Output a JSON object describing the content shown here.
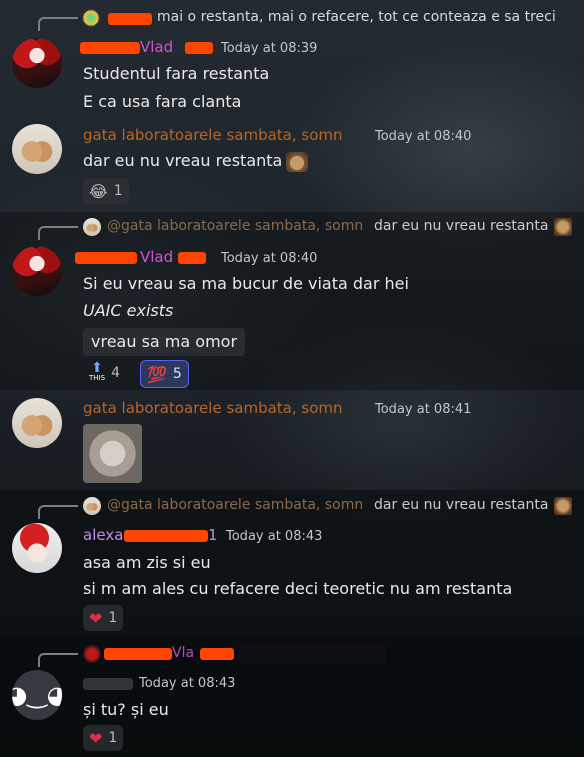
{
  "reply_top": {
    "text": "mai o restanta, mai o refacere, tot ce conteaza e sa treci"
  },
  "messages": {
    "m1": {
      "author": "Vlad",
      "time": "Today at 08:39",
      "lines": [
        "Studentul fara restanta",
        "E ca usa fara clanta"
      ]
    },
    "m2": {
      "author": "gata laboratoarele sambata, somn",
      "time": "Today at 08:40",
      "text": "dar eu nu vreau restanta",
      "reaction": {
        "emoji": "😂",
        "count": "1"
      }
    },
    "m3": {
      "reply_author": "@gata laboratoarele sambata, somn",
      "reply_text": "dar eu nu vreau restanta",
      "author": "Vlad",
      "time": "Today at 08:40",
      "lines": [
        "Si eu vreau sa ma bucur de viata dar hei",
        "UAIC exists"
      ],
      "embed": "vreau sa ma omor",
      "reactions": [
        {
          "emoji": "⬆",
          "label": "THIS",
          "count": "4"
        },
        {
          "emoji": "💯",
          "count": "5"
        }
      ]
    },
    "m4": {
      "author": "gata laboratoarele sambata, somn",
      "time": "Today at 08:41"
    },
    "m5": {
      "reply_author": "@gata laboratoarele sambata, somn",
      "reply_text": "dar eu nu vreau restanta",
      "author": "alexa",
      "author_suffix": "1",
      "time": "Today at 08:43",
      "lines": [
        "asa am zis si eu",
        "si m am ales cu refacere deci teoretic nu am restanta"
      ],
      "reaction": {
        "emoji": "❤",
        "count": "1"
      }
    },
    "m6": {
      "reply_author": "Vla",
      "time": "Today at 08:43",
      "text": "și tu? și eu",
      "reaction": {
        "emoji": "❤",
        "count": "1"
      }
    }
  },
  "colors": {
    "vlad": "#d451d4",
    "gata": "#b8652a",
    "alexa": "#c88ae0",
    "redaction": "#ff4500"
  }
}
